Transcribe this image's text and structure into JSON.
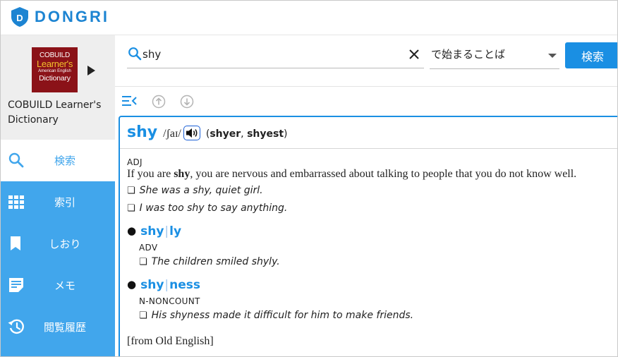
{
  "app": {
    "logo_text": "DONGRI",
    "brand_color": "#1c84d2",
    "accent_color": "#41a6ec"
  },
  "dictionary": {
    "cover": {
      "line1": "COBUILD",
      "line2": "Learner's",
      "line3": "American English",
      "line4": "Dictionary"
    },
    "name": "COBUILD Learner's Dictionary"
  },
  "nav": [
    {
      "label": "検索",
      "icon": "search-icon",
      "active": true
    },
    {
      "label": "索引",
      "icon": "grid-icon",
      "active": false
    },
    {
      "label": "しおり",
      "icon": "bookmark-icon",
      "active": false
    },
    {
      "label": "メモ",
      "icon": "note-icon",
      "active": false
    },
    {
      "label": "閲覧履歴",
      "icon": "history-icon",
      "active": false
    }
  ],
  "search": {
    "query": "shy",
    "mode": "で始まることば",
    "button_label": "検索"
  },
  "entry": {
    "headword": "shy",
    "pronunciation": "/ʃaɪ/",
    "forms_open": "(",
    "form1": "shyer",
    "comma": ", ",
    "form2": "shyest",
    "forms_close": ")",
    "pos": "ADJ",
    "definition_pre": "If you are ",
    "definition_bold": "shy",
    "definition_post": ", you are nervous and embarrassed about talking to people that you do not know well.",
    "examples": [
      "She was a shy, quiet girl.",
      "I was too shy to say anything."
    ],
    "derivatives": [
      {
        "part1": "shy",
        "sep": "|",
        "part2": "ly",
        "pos": "ADV",
        "example": "The children smiled shyly."
      },
      {
        "part1": "shy",
        "sep": "|",
        "part2": "ness",
        "pos": "N-NONCOUNT",
        "example": "His shyness made it difficult for him to make friends."
      }
    ],
    "origin": "[from Old English]"
  }
}
